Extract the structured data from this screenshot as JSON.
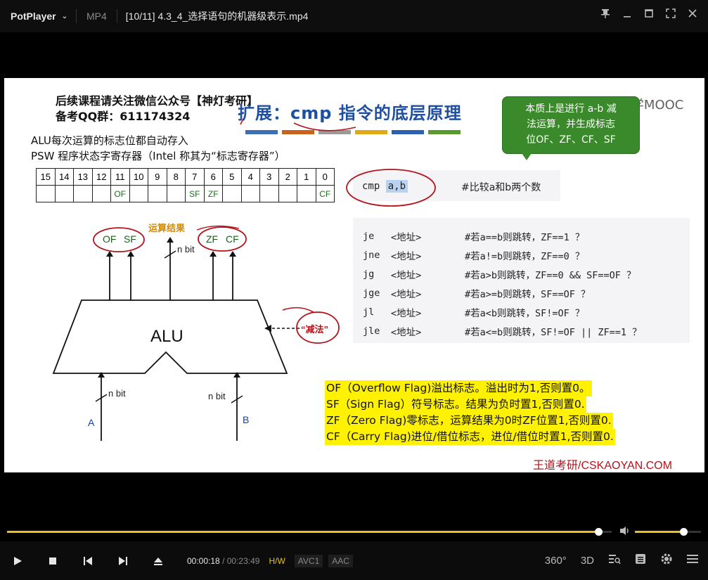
{
  "titlebar": {
    "app_name": "PotPlayer",
    "format": "MP4",
    "filename": "[10/11] 4.3_4_选择语句的机器级表示.mp4"
  },
  "slide": {
    "notice_line1": "后续课程请关注微信公众号【神灯考研】",
    "notice_line2": "备考QQ群：611174324",
    "title": "扩展：cmp 指令的底层原理",
    "title_bar_colors": [
      "#3e6fb5",
      "#c9621b",
      "#9a9a9a",
      "#e0a91a",
      "#2e5fb2",
      "#5a9a2e"
    ],
    "mooc_watermark": "中国大学MOOC",
    "alu_desc_line1": "ALU每次运算的标志位都自动存入",
    "alu_desc_line2": "PSW 程序状态字寄存器（Intel 称其为“标志寄存器”）",
    "callout": {
      "line1": "本质上是进行 a-b 减",
      "line2": "法运算，并生成标志",
      "line3": "位OF、ZF、CF、SF"
    },
    "psw": {
      "bits": [
        "15",
        "14",
        "13",
        "12",
        "11",
        "10",
        "9",
        "8",
        "7",
        "6",
        "5",
        "4",
        "3",
        "2",
        "1",
        "0"
      ],
      "flags": [
        "",
        "",
        "",
        "",
        "OF",
        "",
        "",
        "",
        "SF",
        "ZF",
        "",
        "",
        "",
        "",
        "",
        "CF"
      ]
    },
    "cmp": {
      "mnemonic": "cmp",
      "operands": "a,b",
      "comment": "#比较a和b两个数"
    },
    "jumps": [
      {
        "ins": "je",
        "addr": "<地址>",
        "cond": "#若a==b则跳转，ZF==1 ？"
      },
      {
        "ins": "jne",
        "addr": "<地址>",
        "cond": "#若a!=b则跳转，ZF==0 ？"
      },
      {
        "ins": "jg",
        "addr": "<地址>",
        "cond": "#若a>b则跳转，ZF==0 && SF==OF ？"
      },
      {
        "ins": "jge",
        "addr": "<地址>",
        "cond": "#若a>=b则跳转，SF==OF ？"
      },
      {
        "ins": "jl",
        "addr": "<地址>",
        "cond": "#若a<b则跳转，SF!=OF ？"
      },
      {
        "ins": "jle",
        "addr": "<地址>",
        "cond": "#若a<=b则跳转，SF!=OF || ZF==1 ？"
      }
    ],
    "diagram": {
      "alu_label": "ALU",
      "result_label": "运算结果",
      "nbit_top": "n bit",
      "nbit_left": "n bit",
      "nbit_right": "n bit",
      "input_a": "A",
      "input_b": "B",
      "op_label": "“减法”",
      "flag_of": "OF",
      "flag_sf": "SF",
      "flag_zf": "ZF",
      "flag_cf": "CF"
    },
    "flag_lines": [
      "OF（Overflow Flag)溢出标志。溢出时为1,否则置0。",
      "SF（Sign Flag）符号标志。结果为负时置1,否则置0.",
      "ZF（Zero Flag)零标志，运算结果为0时ZF位置1,否则置0.",
      "CF（Carry Flag)进位/借位标志，进位/借位时置1,否则置0."
    ],
    "footer_brand": "王道考研/CSKAOYAN.COM"
  },
  "player": {
    "current_time": "00:00:18",
    "separator": "/",
    "total_time": "00:23:49",
    "badges": [
      "H/W",
      "AVC1",
      "AAC"
    ],
    "seek_progress": 0.978,
    "volume_level": 0.73,
    "right_labels": {
      "v360": "360°",
      "v3d": "3D"
    }
  },
  "colors": {
    "accent": "#e8c21a",
    "callout_green": "#3a8a2b",
    "title_blue": "#1f4fa0",
    "highlight_yellow": "#fff200",
    "annotation_red": "#b3141c"
  }
}
